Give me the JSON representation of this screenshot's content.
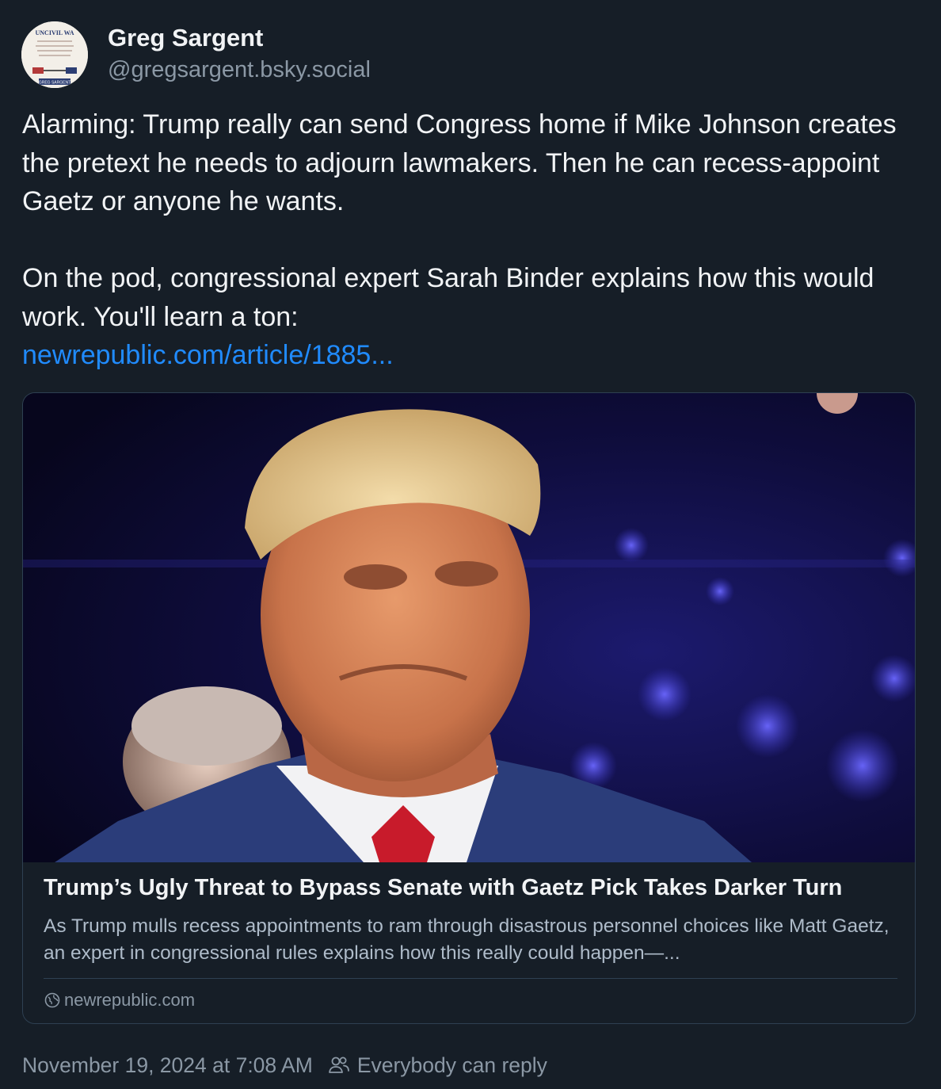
{
  "author": {
    "display_name": "Greg Sargent",
    "handle": "@gregsargent.bsky.social",
    "avatar_text_top": "UNCIVIL WA",
    "avatar_text_bottom": "GREG SARGENT"
  },
  "post": {
    "paragraph_1": "Alarming: Trump really can send Congress home if Mike Johnson creates the pretext he needs to adjourn lawmakers. Then he can recess-appoint Gaetz or anyone he wants.",
    "paragraph_2": "On the pod, congressional expert Sarah Binder explains how this would work. You'll learn a ton:",
    "link_text": "newrepublic.com/article/1885..."
  },
  "card": {
    "title": "Trump’s Ugly Threat to Bypass Senate with Gaetz Pick Takes Darker Turn",
    "description": "As Trump mulls recess appointments to ram through disastrous personnel choices like Matt Gaetz, an expert in congressional rules explains how this really could happen—...",
    "domain": "newrepublic.com",
    "image_icon": "photo-trump-portrait"
  },
  "footer": {
    "timestamp": "November 19, 2024 at 7:08 AM",
    "reply_setting": "Everybody can reply",
    "reply_icon": "people-icon"
  },
  "colors": {
    "background": "#161e27",
    "link": "#208bfe",
    "muted": "#8b98a5",
    "border": "#2e4052"
  }
}
